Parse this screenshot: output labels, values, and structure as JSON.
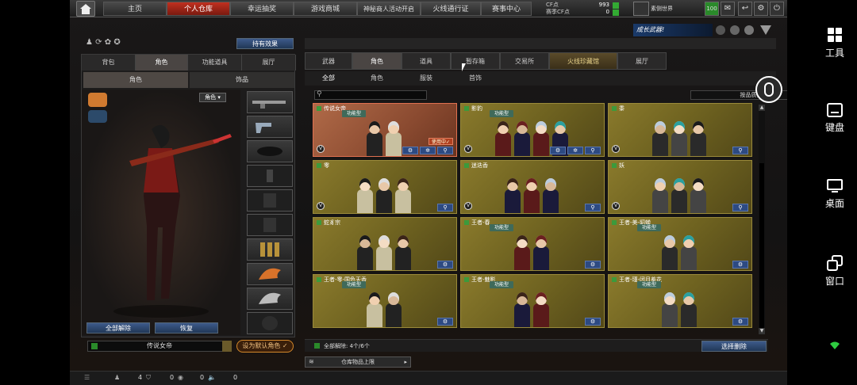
{
  "topbar": {
    "tabs": [
      "主页",
      "个人仓库",
      "幸运抽奖",
      "游戏商城",
      "神秘商人活动开启",
      "火线通行证",
      "赛事中心"
    ],
    "cf_label": "CF点",
    "cf_value": "993",
    "season_cf_label": "赛季CF点",
    "season_cf_value": "0",
    "world_label": "素侧世界",
    "level": "100"
  },
  "left": {
    "effect_button": "持有效果",
    "tabs": [
      "背包",
      "角色",
      "功能道具",
      "展厅"
    ],
    "subtabs": [
      "角色",
      "饰品"
    ],
    "role_filter": "角色",
    "unequip_all": "全部解除",
    "restore": "恢复",
    "current_role": "传说女帝",
    "set_default": "设为默认角色"
  },
  "right": {
    "tabs": [
      "武器",
      "角色",
      "道具",
      "暂存箱",
      "交易所",
      "火线珍藏馆",
      "展厅"
    ],
    "subtabs": [
      "全部",
      "角色",
      "服装",
      "首饰"
    ],
    "sort_label": "按品质排序",
    "banner": "成长武器!",
    "cards": [
      {
        "name": "传说女帝",
        "tag": "功能型",
        "using": "使用中✓",
        "selected": true,
        "figs": 2
      },
      {
        "name": "影豹",
        "tag": "功能型",
        "figs": 4
      },
      {
        "name": "黍",
        "figs": 3
      },
      {
        "name": "零",
        "figs": 3
      },
      {
        "name": "迷迭香",
        "figs": 3
      },
      {
        "name": "妖",
        "figs": 3
      },
      {
        "name": "蛇豸宗",
        "figs": 3
      },
      {
        "name": "王者-春",
        "tag": "功能型",
        "figs": 2
      },
      {
        "name": "王者-美-貂蝉",
        "tag": "功能型",
        "figs": 2
      },
      {
        "name": "王者-零-国色天香",
        "tag": "功能型",
        "figs": 2
      },
      {
        "name": "王者-魅影",
        "tag": "功能型",
        "figs": 2
      },
      {
        "name": "王者-瑾-闭月羞花",
        "tag": "功能型",
        "figs": 2
      }
    ],
    "unequip_count": "全部解除: 4个/6个",
    "select_delete": "选择删除",
    "storage_limit": "仓库物品上限"
  },
  "bottom": {
    "a": "4",
    "b": "0",
    "c": "0",
    "d": "0"
  },
  "side": {
    "items": [
      "工具",
      "键盘",
      "桌面",
      "窗口"
    ]
  }
}
